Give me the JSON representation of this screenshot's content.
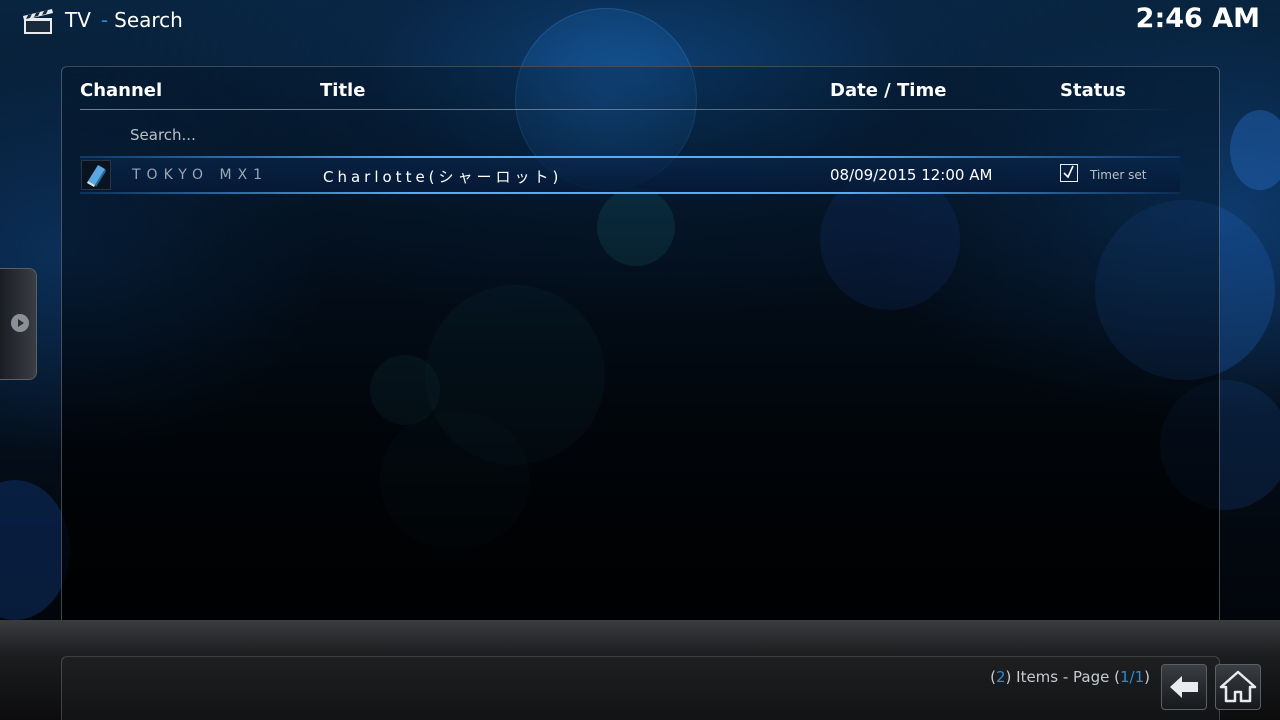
{
  "header": {
    "section": "TV",
    "separator": "-",
    "page": "Search",
    "clock": "2:46 AM"
  },
  "columns": {
    "channel": "Channel",
    "title": "Title",
    "datetime": "Date / Time",
    "status": "Status"
  },
  "search": {
    "label": "Search..."
  },
  "results": [
    {
      "channel": "TOKYO MX1",
      "title": "Charlotte(シャーロット)",
      "datetime": "08/09/2015 12:00 AM",
      "status": "Timer set"
    }
  ],
  "footer": {
    "items_open": "(",
    "items_count": "2",
    "items_mid": ") Items - Page (",
    "page_current": "1/1",
    "items_close": ")"
  },
  "icons": {
    "header": "clapperboard-icon",
    "side_tab": "arrow-right-icon",
    "back": "back-arrow-icon",
    "home": "home-icon",
    "status": "checkbox-checked-icon",
    "channel_thumb": "channel-logo-icon"
  },
  "colors": {
    "accent": "#2a8bd8",
    "selection_glow": "#5ab4ff",
    "text_muted": "#9aa6b2"
  }
}
